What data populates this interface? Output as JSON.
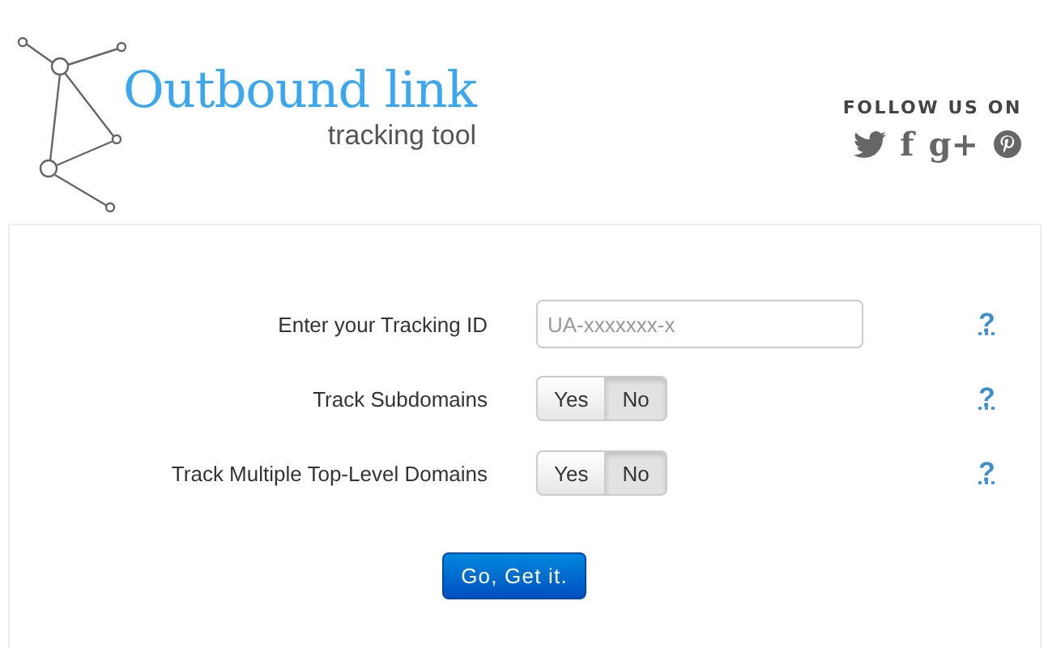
{
  "logo": {
    "title": "Outbound link",
    "subtitle": "tracking tool"
  },
  "social": {
    "heading": "FOLLOW US ON",
    "icons": [
      {
        "kind": "twitter"
      },
      {
        "kind": "text",
        "label": "f"
      },
      {
        "kind": "text",
        "label": "g+"
      },
      {
        "kind": "pinterest"
      }
    ]
  },
  "form": {
    "rows": [
      {
        "kind": "input",
        "label": "Enter your Tracking ID",
        "placeholder": "UA-xxxxxxx-x",
        "help": "?"
      },
      {
        "kind": "toggle",
        "label": "Track Subdomains",
        "options": [
          {
            "label": "Yes",
            "selected": false
          },
          {
            "label": "No",
            "selected": true
          }
        ],
        "help": "?"
      },
      {
        "kind": "toggle",
        "label": "Track Multiple Top-Level Domains",
        "options": [
          {
            "label": "Yes",
            "selected": false
          },
          {
            "label": "No",
            "selected": true
          }
        ],
        "help": "?"
      }
    ],
    "submit": "Go, Get it."
  }
}
